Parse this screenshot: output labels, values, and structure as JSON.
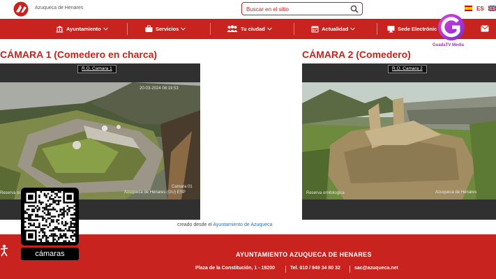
{
  "header": {
    "site_name": "Azuqueca de Henares",
    "search_placeholder": "Buscar en el sitio",
    "lang_current": "ES"
  },
  "nav": {
    "items": [
      {
        "label": "Ayuntamiento",
        "icon": "building-icon"
      },
      {
        "label": "Servicios",
        "icon": "briefcase-icon"
      },
      {
        "label": "Tu ciudad",
        "icon": "people-icon"
      },
      {
        "label": "Actualidad",
        "icon": "calendar-icon"
      },
      {
        "label": "Sede Electrónic",
        "icon": "monitor-icon"
      }
    ]
  },
  "watermark": {
    "label": "GuadaTV Media"
  },
  "cameras": [
    {
      "title": "CÁMARA 1 (Comedero en charca)",
      "tag": "R.O. Camara 1",
      "timestamp": "20-03-2024 08:19:53",
      "overlay_left": "Reserva ornitológica",
      "overlay_right": "Camara 01",
      "overlay_right2": "Azuqueca de Henares (GU) ESP"
    },
    {
      "title": "CÁMARA 2 (Comedero)",
      "tag": "R.O. Camara 2",
      "overlay_left": "Reserva ornitologica",
      "overlay_right": "Azuqueca de Henares"
    }
  ],
  "credit": {
    "prefix": "creado desde el",
    "link": "Ayuntamiento de Azuqueca"
  },
  "qr": {
    "label": "cámaras"
  },
  "footer": {
    "title": "AYUNTAMIENTO AZUQUECA DE HENARES",
    "address": "Plaza de la Constitución, 1 - 19200",
    "phone": "Tel. 010 / 949 34 80 32",
    "email": "sac@azuqueca.net"
  },
  "colors": {
    "brand_red": "#c8231e",
    "link_blue": "#2f6eb5",
    "watermark_purple": "#a42ec0"
  }
}
